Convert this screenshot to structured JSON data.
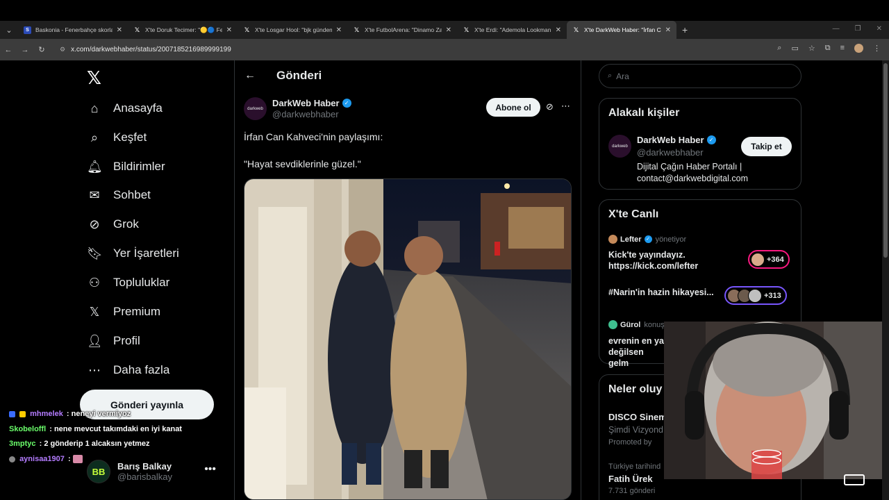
{
  "browser": {
    "tabs": [
      {
        "favicon": "baskonia-icon",
        "title": "Baskonia - Fenerbahçe skorlar"
      },
      {
        "favicon": "x-icon",
        "title": "X'te Doruk Tecimer: \"🟡🔵 Fen"
      },
      {
        "favicon": "x-icon",
        "title": "X'te Losgar Hool: \"bjk gündem"
      },
      {
        "favicon": "x-icon",
        "title": "X'te FutbolArena: \"Dinamo Zag"
      },
      {
        "favicon": "x-icon",
        "title": "X'te Erdi: \"Ademola Lookman"
      },
      {
        "favicon": "x-icon",
        "title": "X'te DarkWeb Haber: \"İrfan Can",
        "active": true
      }
    ],
    "url": "x.com/darkwebhaber/status/2007185216989999199"
  },
  "leftnav": {
    "items": [
      {
        "label": "Anasayfa",
        "icon": "home-icon"
      },
      {
        "label": "Keşfet",
        "icon": "search-icon"
      },
      {
        "label": "Bildirimler",
        "icon": "bell-icon"
      },
      {
        "label": "Sohbet",
        "icon": "mail-icon"
      },
      {
        "label": "Grok",
        "icon": "grok-icon"
      },
      {
        "label": "Yer İşaretleri",
        "icon": "bookmark-icon"
      },
      {
        "label": "Topluluklar",
        "icon": "communities-icon"
      },
      {
        "label": "Premium",
        "icon": "x-icon"
      },
      {
        "label": "Profil",
        "icon": "person-icon"
      },
      {
        "label": "Daha fazla",
        "icon": "more-circle-icon"
      }
    ],
    "post_button": "Gönderi yayınla",
    "me": {
      "name": "Barış Balkay",
      "handle": "@barisbalkay",
      "avatar_text": "BB"
    }
  },
  "main": {
    "header_title": "Gönderi",
    "author": {
      "name": "DarkWeb Haber",
      "handle": "@darkwebhaber",
      "avatar_text": "darkweb"
    },
    "subscribe_label": "Abone ol",
    "text_lines": [
      "İrfan Can Kahveci'nin paylaşımı:",
      "\"Hayat sevdiklerinle güzel.\""
    ]
  },
  "right": {
    "search_placeholder": "Ara",
    "related": {
      "title": "Alakalı kişiler",
      "name": "DarkWeb Haber",
      "handle": "@darkwebhaber",
      "bio": "Dijital Çağın Haber Portalı | contact@darkwebdigital.com",
      "follow_label": "Takip et"
    },
    "live": {
      "title": "X'te Canlı",
      "item1": {
        "host": "Lefter",
        "role": "yönetiyor",
        "title": "Kick'te yayındayız. https://kick.com/lefter",
        "count": "+364"
      },
      "item2": {
        "title": "#Narin'in hazin hikayesi...",
        "count": "+313"
      },
      "item3": {
        "host": "Gürol",
        "role": "konuş",
        "title": "evrenin en ya değilsen gelm"
      }
    },
    "trends": {
      "title": "Neler oluy",
      "t1_name": "DISCO Sinem",
      "t1_sub": "Şimdi Vizyond",
      "t1_promo": "Promoted by",
      "t2_meta": "Türkiye tarihind",
      "t2_name": "Fatih Ürek",
      "t2_count": "7.731 gönderi"
    }
  },
  "chat": [
    {
      "user": "mhmelek",
      "message": "neneyi vermiyoz",
      "color": "#b47cff"
    },
    {
      "user": "Skobeloffl",
      "message": "nene mevcut takımdaki en iyi kanat",
      "color": "#6bff6b"
    },
    {
      "user": "3mptyc",
      "message": "2 gönderip 1 alcaksın yetmez",
      "color": "#6bff6b"
    },
    {
      "user": "aynisaa1907",
      "message": "",
      "color": "#b47cff"
    }
  ]
}
